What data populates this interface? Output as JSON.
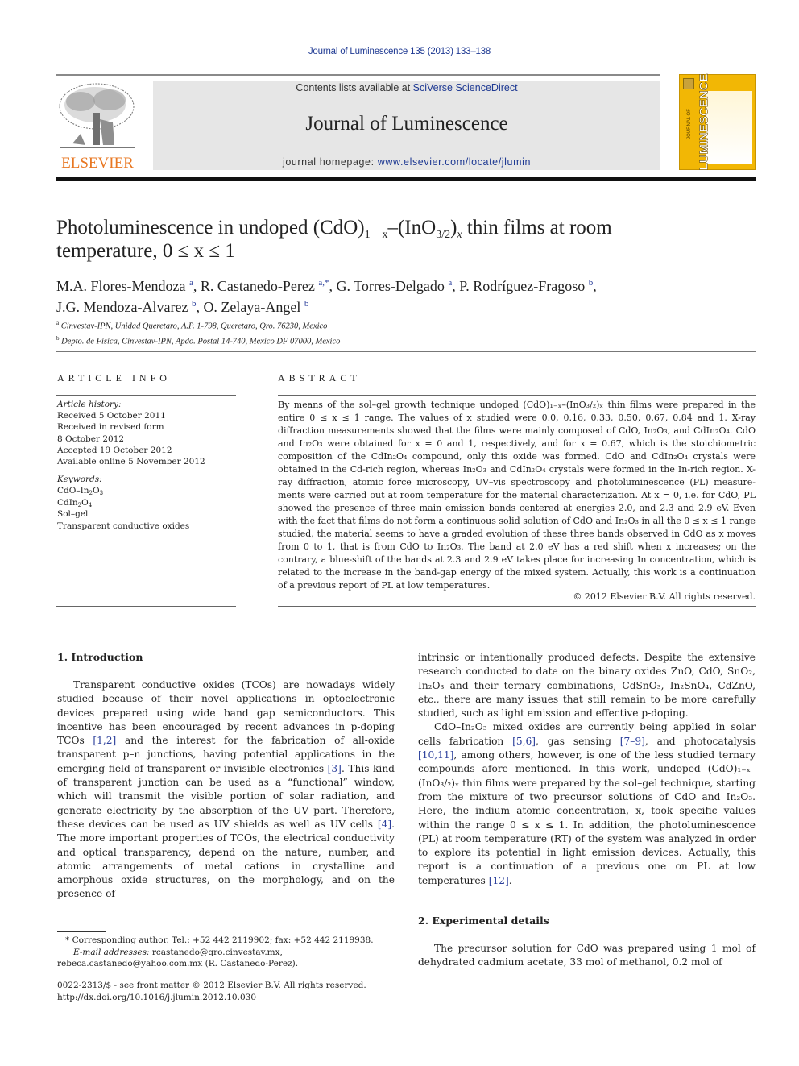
{
  "header": {
    "citation": "Journal of Luminescence 135 (2013) 133–138",
    "contents_prefix": "Contents lists available at ",
    "contents_link": "SciVerse ScienceDirect",
    "journal_name": "Journal of Luminescence",
    "homepage_prefix": "journal homepage: ",
    "homepage_link": "www.elsevier.com/locate/jlumin",
    "publisher_logo_text": "ELSEVIER",
    "cover_title": "LUMINESCENCE",
    "cover_subtitle": "JOURNAL OF",
    "colors": {
      "publisher_orange": "#e87722",
      "link_blue": "#1f3a93",
      "cover_yellow": "#f2b705"
    }
  },
  "article": {
    "title_part1": "Photoluminescence in undoped (CdO)",
    "title_sub1": "1 − x",
    "title_part2": "–(InO",
    "title_sub2": "3/2",
    "title_part3": ")",
    "title_sub3": "x",
    "title_part4": " thin films at room",
    "title_line2": "temperature, 0 ≤ x ≤ 1",
    "authors": [
      {
        "name": "M.A. Flores-Mendoza",
        "aff": "a",
        "sep": ", "
      },
      {
        "name": "R. Castanedo-Perez",
        "aff": "a,*",
        "sep": ", "
      },
      {
        "name": "G. Torres-Delgado",
        "aff": "a",
        "sep": ", "
      },
      {
        "name": "P. Rodríguez-Fragoso",
        "aff": "b",
        "sep": ","
      },
      {
        "name": "J.G. Mendoza-Alvarez",
        "aff": "b",
        "sep": ", "
      },
      {
        "name": "O. Zelaya-Angel",
        "aff": "b",
        "sep": ""
      }
    ],
    "affiliations": [
      {
        "mark": "a",
        "text": "Cinvestav-IPN, Unidad Queretaro, A.P. 1-798, Queretaro, Qro. 76230, Mexico"
      },
      {
        "mark": "b",
        "text": "Depto. de Fisica, Cinvestav-IPN, Apdo. Postal 14-740, Mexico DF 07000, Mexico"
      }
    ]
  },
  "article_info": {
    "heading": "ARTICLE INFO",
    "history_label": "Article history:",
    "history": [
      "Received 5 October 2011",
      "Received in revised form",
      "8 October 2012",
      "Accepted 19 October 2012",
      "Available online 5 November 2012"
    ],
    "keywords_label": "Keywords:",
    "keywords": [
      "CdO–In2O3",
      "CdIn2O4",
      "Sol–gel",
      "Transparent conductive oxides"
    ]
  },
  "abstract": {
    "heading": "ABSTRACT",
    "lines": [
      "By means of the sol–gel growth technique undoped (CdO)₁₋ₓ–(InO₃/₂)ₓ thin films were prepared in the entire 0 ≤ x ≤ 1 range. The values of x studied were 0.0, 0.16, 0.33, 0.50, 0.67, 0.84 and 1. X-ray diffraction measurements showed that the films were mainly composed of CdO, In₂O₃, and CdIn₂O₄. CdO and In₂O₃ were obtained for x = 0 and 1, respectively, and for x = 0.67, which is the stoichiometric composition of the CdIn₂O₄ compound, only this oxide was formed. CdO and CdIn₂O₄ crystals were obtained in the Cd-rich region, whereas In₂O₃ and CdIn₂O₄ crystals were formed in the In-rich region. X-ray diffraction, atomic force microscopy, UV–vis spectroscopy and photoluminescence (PL) measure-ments were carried out at room temperature for the material characterization. At x = 0, i.e. for CdO, PL showed the presence of three main emission bands centered at energies 2.0, and 2.3 and 2.9 eV. Even with the fact that films do not form a continuous solid solution of CdO and In₂O₃ in all the 0 ≤ x ≤ 1 range studied, the material seems to have a graded evolution of these three bands observed in CdO as x moves from 0 to 1, that is from CdO to In₂O₃. The band at 2.0 eV has a red shift when x increases; on the contrary, a blue-shift of the bands at 2.3 and 2.9 eV takes place for increasing In concentration, which is related to the increase in the band-gap energy of the mixed system. Actually, this work is a continuation of a previous report of PL at low temperatures."
    ],
    "copyright": "© 2012 Elsevier B.V. All rights reserved."
  },
  "body": {
    "intro_heading": "1.  Introduction",
    "intro_p1_a": "Transparent conductive oxides (TCOs) are nowadays widely studied because of their novel applications in optoelectronic devices prepared using wide band gap semiconductors. This incentive has been encouraged by recent advances in p-doping TCOs ",
    "ref_1_2": "[1,2]",
    "intro_p1_b": " and the interest for the fabrication of all-oxide transparent p–n junctions, having potential applications in the emerging field of transparent or invisible electronics ",
    "ref_3": "[3]",
    "intro_p1_c": ". This kind of transparent junction can be used as a “functional” window, which will transmit the visible portion of solar radiation, and generate electricity by the absorption of the UV part. Therefore, these devices can be used as UV shields as well as UV cells ",
    "ref_4": "[4]",
    "intro_p1_d": ". The more important properties of TCOs, the electrical conductivity and optical transparency, depend on the nature, number, and atomic arrangements of metal cations in crystalline and amorphous oxide structures, on the morphology, and on the presence of",
    "right_p1": "intrinsic or intentionally produced defects. Despite the extensive research conducted to date on the binary oxides ZnO, CdO, SnO₂, In₂O₃ and their ternary combinations, CdSnO₃, In₂SnO₄, CdZnO, etc., there are many issues that still remain to be more carefully studied, such as light emission and effective p-doping.",
    "right_p2_a": "CdO–In₂O₃ mixed oxides are currently being applied in solar cells fabrication ",
    "ref_5_6": "[5,6]",
    "right_p2_b": ", gas sensing ",
    "ref_7_9": "[7–9]",
    "right_p2_c": ", and photocatalysis ",
    "ref_10_11": "[10,11]",
    "right_p2_d": ", among others, however, is one of the less studied ternary compounds afore mentioned. In this work, undoped (CdO)₁₋ₓ–(InO₃/₂)ₓ thin films were prepared by the sol–gel technique, starting from the mixture of two precursor solutions of CdO and In₂O₃. Here, the indium atomic concentration, x, took specific values within the range 0 ≤ x ≤ 1. In addition, the photoluminescence (PL) at room temperature (RT) of the system was analyzed in order to explore its potential in light emission devices. Actually, this report is a continuation of a previous one on PL at low temperatures ",
    "ref_12": "[12]",
    "right_p2_e": ".",
    "exp_heading": "2.  Experimental details",
    "exp_p1": "The precursor solution for CdO was prepared using 1 mol of dehydrated cadmium acetate, 33 mol of methanol, 0.2 mol of"
  },
  "footnotes": {
    "corresponding": "* Corresponding author. Tel.: +52 442 2119902; fax: +52 442 2119938.",
    "email_label": "E-mail addresses:",
    "email_1": " rcastanedo@qro.cinvestav.mx,",
    "email_2": "rebeca.castanedo@yahoo.com.mx (R. Castanedo-Perez).",
    "front_matter": "0022-2313/$ - see front matter © 2012 Elsevier B.V. All rights reserved.",
    "doi": "http://dx.doi.org/10.1016/j.jlumin.2012.10.030"
  }
}
